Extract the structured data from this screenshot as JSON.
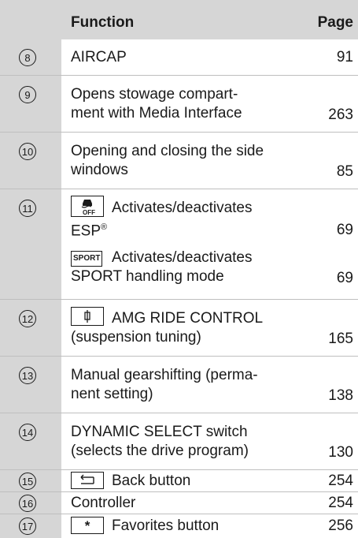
{
  "header": {
    "function": "Function",
    "page": "Page"
  },
  "rows": [
    {
      "num": "8",
      "text": "AIRCAP",
      "page": "91"
    },
    {
      "num": "9",
      "line1": "Opens stowage compart-",
      "line2": "ment with Media Interface",
      "page": "263"
    },
    {
      "num": "10",
      "line1": "Opening and closing the side",
      "line2": "windows",
      "page": "85"
    },
    {
      "num": "11",
      "esp_line1": "Activates/deactivates",
      "esp_line2": "ESP",
      "esp_reg": "®",
      "esp_page": "69",
      "sport_key": "SPORT",
      "sport_line1": "Activates/deactivates",
      "sport_line2": "SPORT handling mode",
      "sport_page": "69"
    },
    {
      "num": "12",
      "line1": "AMG RIDE CONTROL",
      "line2": "(suspension tuning)",
      "page": "165"
    },
    {
      "num": "13",
      "line1": "Manual gearshifting (perma-",
      "line2": "nent setting)",
      "page": "138"
    },
    {
      "num": "14",
      "line1": "DYNAMIC SELECT switch",
      "line2": "(selects the drive program)",
      "page": "130"
    },
    {
      "num": "15",
      "text": "Back button",
      "page": "254"
    },
    {
      "num": "16",
      "text": "Controller",
      "page": "254"
    },
    {
      "num": "17",
      "key": "*",
      "text": "Favorites button",
      "page": "256"
    }
  ],
  "icons": {
    "esp_key": "esp-off-icon",
    "ride_key": "suspension-icon",
    "back_key": "back-arrow-icon",
    "fav_key": "star-key-icon"
  }
}
